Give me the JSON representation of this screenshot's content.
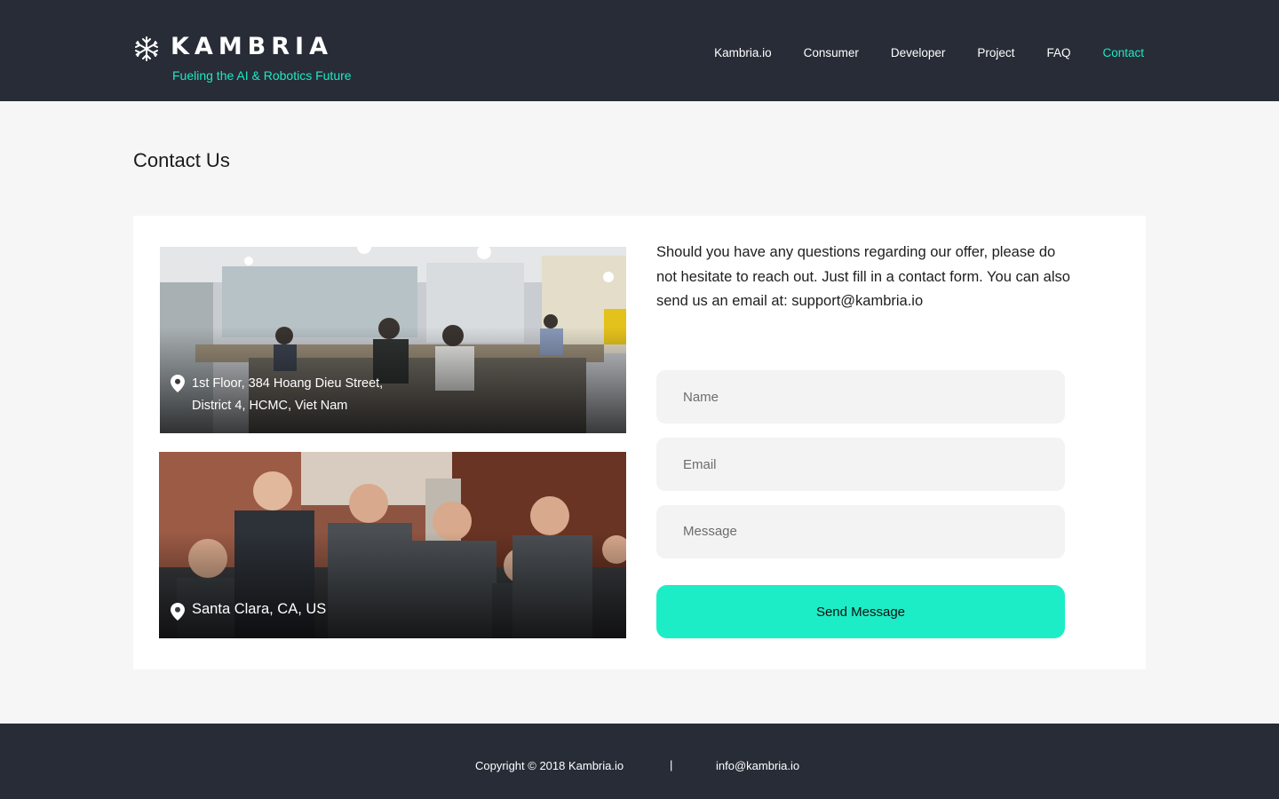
{
  "header": {
    "brand": "KAMBRIA",
    "tagline": "Fueling the AI & Robotics Future",
    "nav": [
      {
        "label": "Kambria.io"
      },
      {
        "label": "Consumer"
      },
      {
        "label": "Developer"
      },
      {
        "label": "Project"
      },
      {
        "label": "FAQ"
      },
      {
        "label": "Contact",
        "active": true
      }
    ],
    "accent_color": "#1de9c4",
    "background_color": "#272c37"
  },
  "page": {
    "title": "Contact Us"
  },
  "locations": [
    {
      "address_line1": "1st Floor, 384 Hoang Dieu Street,",
      "address_line2": "District 4, HCMC, Viet Nam",
      "photo": "office-interior-photo",
      "icon": "map-pin-icon"
    },
    {
      "address_line1": "Santa Clara, CA, US",
      "photo": "team-group-photo",
      "icon": "map-pin-icon"
    }
  ],
  "contact": {
    "intro": "Should you have any questions regarding our offer, please do not hesitate to reach out. Just fill in a contact form. You can also send us an email at: support@kambria.io",
    "name_placeholder": "Name",
    "email_placeholder": "Email",
    "message_placeholder": "Message",
    "send_label": "Send Message",
    "button_color": "#1dedc6"
  },
  "footer": {
    "copyright": "Copyright © 2018 Kambria.io",
    "separator": "|",
    "email": "info@kambria.io"
  }
}
